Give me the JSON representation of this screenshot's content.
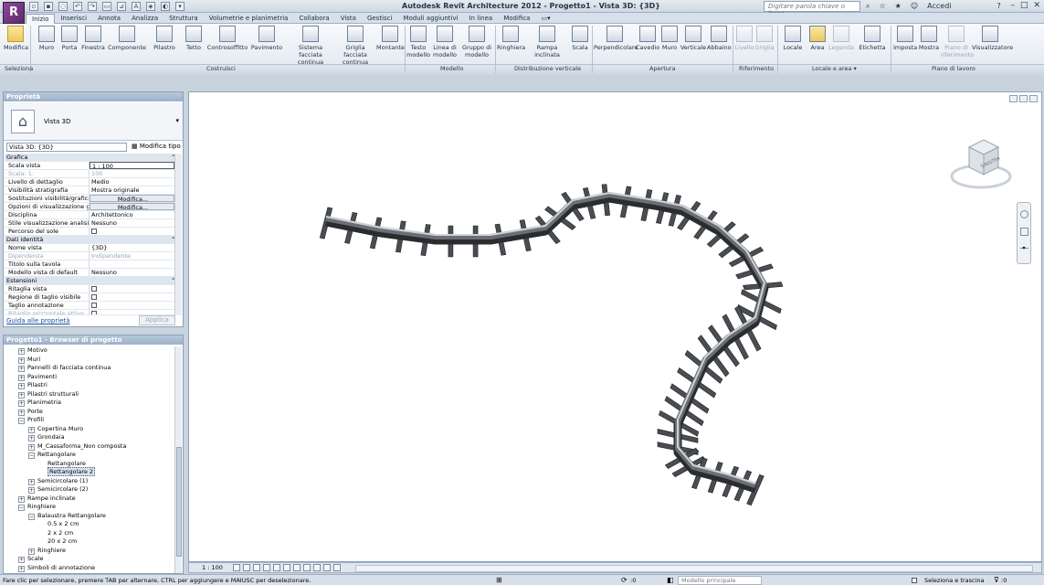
{
  "title_bar": {
    "title": "Autodesk Revit Architecture 2012 -    Progetto1 - Vista 3D: {3D}",
    "search_placeholder": "Digitare parola chiave o frase",
    "signin": "Accedi",
    "help": "?"
  },
  "ribbon": {
    "tabs": [
      "Inizio",
      "Inserisci",
      "Annota",
      "Analizza",
      "Struttura",
      "Volumetrie e planimetria",
      "Collabora",
      "Vista",
      "Gestisci",
      "Moduli aggiuntivi",
      "In linea",
      "Modifica"
    ],
    "buttons": {
      "modifica": "Modifica",
      "muro": "Muro",
      "porta": "Porta",
      "finestra": "Finestra",
      "componente": "Componente",
      "pilastro": "Pilastro",
      "tetto": "Tetto",
      "controsoffitto": "Controsoffitto",
      "pavimento": "Pavimento",
      "sistema_facciata": "Sistema facciata continua",
      "griglia_facciata": "Griglia facciata continua",
      "montante": "Montante",
      "testo_modello": "Testo modello",
      "linea_modello": "Linea di modello",
      "gruppo_modello": "Gruppo di modello",
      "ringhiera": "Ringhiera",
      "rampa_inclinata": "Rampa inclinata",
      "scala": "Scala",
      "perpendicolare": "Perpendicolare",
      "cavedio": "Cavedio",
      "muro_apertura": "Muro",
      "verticale": "Verticale",
      "abbaino": "Abbaino",
      "livello": "Livello",
      "griglia": "Griglia",
      "locale": "Locale",
      "area": "Area",
      "legenda": "Legenda",
      "etichetta": "Etichetta",
      "imposta": "Imposta",
      "mostra": "Mostra",
      "piano_rif": "Piano di riferimento",
      "visualizzatore": "Visualizzatore"
    },
    "panels": {
      "seleziona": "Seleziona",
      "costruisci": "Costruisci",
      "modello": "Modello",
      "distribuzione": "Distribuzione verticale",
      "apertura": "Apertura",
      "riferimento": "Riferimento",
      "locale_area": "Locale e area ▾",
      "piano_lavoro": "Piano di lavoro"
    }
  },
  "properties": {
    "header": "Proprietà",
    "type_name": "Vista 3D",
    "view_selector": "Vista 3D: {3D}",
    "edit_type": "Modifica tipo",
    "groups": {
      "grafica": "Grafica",
      "dati": "Dati identità",
      "estensioni": "Estensioni"
    },
    "rows_grafica": [
      {
        "k": "Scala vista",
        "v": "1 : 100"
      },
      {
        "k": "Scala: 1:",
        "v": "100"
      },
      {
        "k": "Livello di dettaglio",
        "v": "Medio"
      },
      {
        "k": "Visibilità stratigrafia",
        "v": "Mostra originale"
      },
      {
        "k": "Sostituzioni visibilità/grafica",
        "v": "Modifica..."
      },
      {
        "k": "Opzioni di visualizzazione gr...",
        "v": "Modifica..."
      },
      {
        "k": "Disciplina",
        "v": "Architettonico"
      },
      {
        "k": "Stile visualizzazione analisi d...",
        "v": "Nessuno"
      },
      {
        "k": "Percorso del sole",
        "v": ""
      }
    ],
    "rows_dati": [
      {
        "k": "Nome vista",
        "v": "{3D}"
      },
      {
        "k": "Dipendenza",
        "v": "Indipendente"
      },
      {
        "k": "Titolo sulla tavola",
        "v": ""
      },
      {
        "k": "Modello vista di default",
        "v": "Nessuno"
      }
    ],
    "rows_estensioni": [
      {
        "k": "Ritaglia vista",
        "v": ""
      },
      {
        "k": "Regione di taglio visibile",
        "v": ""
      },
      {
        "k": "Taglio annotazione",
        "v": ""
      },
      {
        "k": "Ritaglio orizzontale attivo",
        "v": ""
      }
    ],
    "help_link": "Guida alle proprietà",
    "apply": "Applica"
  },
  "browser": {
    "header": "Progetto1 - Browser di progetto",
    "nodes": [
      {
        "label": "Motivo",
        "depth": 1,
        "toggle": "+"
      },
      {
        "label": "Muri",
        "depth": 1,
        "toggle": "+"
      },
      {
        "label": "Pannelli di facciata continua",
        "depth": 1,
        "toggle": "+"
      },
      {
        "label": "Pavimenti",
        "depth": 1,
        "toggle": "+"
      },
      {
        "label": "Pilastri",
        "depth": 1,
        "toggle": "+"
      },
      {
        "label": "Pilastri strutturali",
        "depth": 1,
        "toggle": "+"
      },
      {
        "label": "Planimetria",
        "depth": 1,
        "toggle": "+"
      },
      {
        "label": "Porte",
        "depth": 1,
        "toggle": "+"
      },
      {
        "label": "Profili",
        "depth": 1,
        "toggle": "-"
      },
      {
        "label": "Copertina Muro",
        "depth": 2,
        "toggle": "+"
      },
      {
        "label": "Grondaia",
        "depth": 2,
        "toggle": "+"
      },
      {
        "label": "M_Cassaforma_Non composta",
        "depth": 2,
        "toggle": "+"
      },
      {
        "label": "Rettangolare",
        "depth": 2,
        "toggle": "-"
      },
      {
        "label": "Rettangolare",
        "depth": 3,
        "toggle": ""
      },
      {
        "label": "Rettangolare 2",
        "depth": 3,
        "toggle": "",
        "highlight": true
      },
      {
        "label": "Semicircolare (1)",
        "depth": 2,
        "toggle": "+"
      },
      {
        "label": "Semicircolare (2)",
        "depth": 2,
        "toggle": "+"
      },
      {
        "label": "Rampe inclinate",
        "depth": 1,
        "toggle": "+"
      },
      {
        "label": "Ringhiere",
        "depth": 1,
        "toggle": "-"
      },
      {
        "label": "Balaustra Rettangolare",
        "depth": 2,
        "toggle": "-"
      },
      {
        "label": "0.5 x 2 cm",
        "depth": 3,
        "toggle": ""
      },
      {
        "label": "2 x 2 cm",
        "depth": 3,
        "toggle": ""
      },
      {
        "label": "20 x 2 cm",
        "depth": 3,
        "toggle": ""
      },
      {
        "label": "Ringhiere",
        "depth": 2,
        "toggle": "+"
      },
      {
        "label": "Scale",
        "depth": 1,
        "toggle": "+"
      },
      {
        "label": "Simboli di annotazione",
        "depth": 1,
        "toggle": "+"
      }
    ]
  },
  "view": {
    "viewcube_face": "SINISTRA",
    "scale": "1 : 100"
  },
  "status": {
    "text": "Fare clic per selezionare, premere TAB per alternare, CTRL per aggiungere e MAIUSC per deselezionare.",
    "zero": ":0",
    "model": "Modello principale",
    "select_drag": "Seleziona e trascina",
    "filter": ":0"
  }
}
